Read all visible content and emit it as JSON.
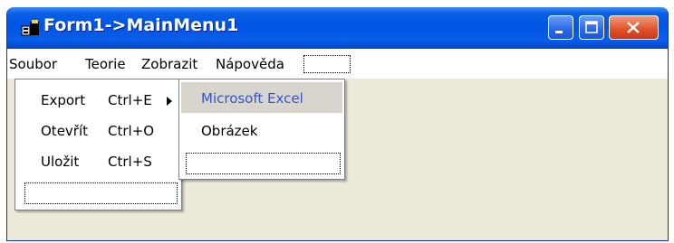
{
  "window": {
    "title": "Form1->MainMenu1"
  },
  "menubar": {
    "items": [
      "Soubor",
      "Teorie",
      "Zobrazit",
      "Nápověda"
    ]
  },
  "popup": {
    "items": [
      {
        "label": "Export",
        "shortcut": "Ctrl+E"
      },
      {
        "label": "Otevřít",
        "shortcut": "Ctrl+O"
      },
      {
        "label": "Uložit",
        "shortcut": "Ctrl+S"
      }
    ]
  },
  "submenu": {
    "items": [
      "Microsoft Excel",
      "Obrázek"
    ]
  },
  "colors": {
    "titlebar": "#0054E3",
    "client": "#ECE9D8",
    "highlight_text": "#3355CC"
  },
  "icons": [
    "app-icon",
    "minimize-icon",
    "maximize-icon",
    "close-icon",
    "submenu-arrow-icon"
  ]
}
